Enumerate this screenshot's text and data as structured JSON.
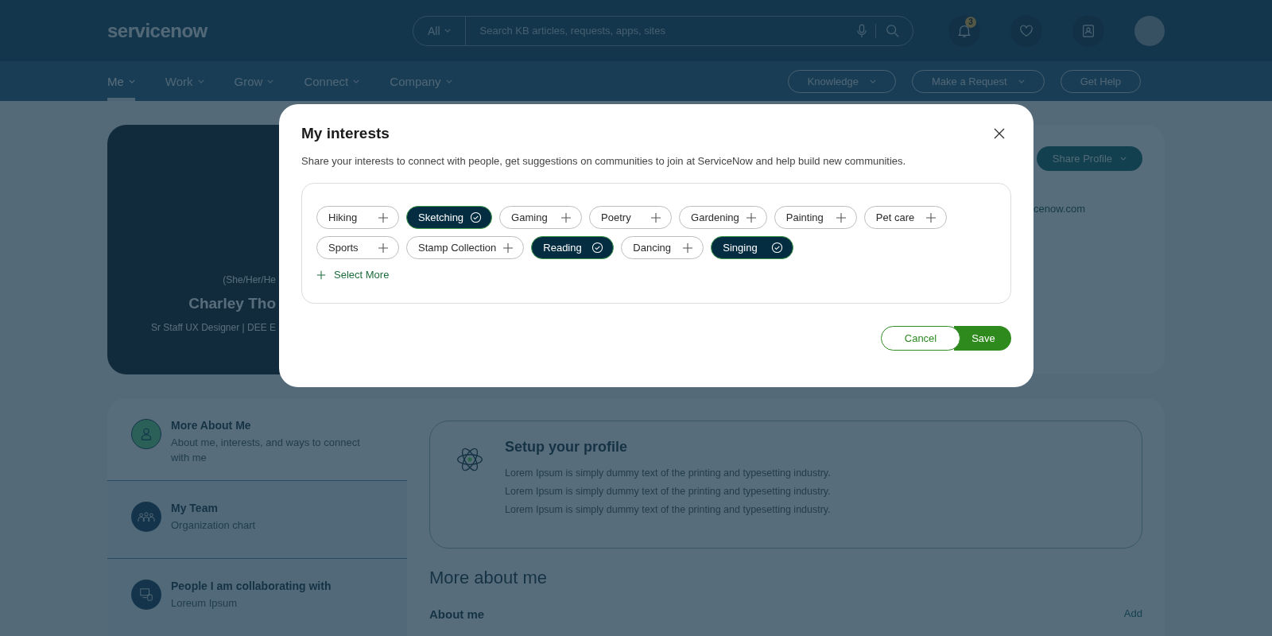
{
  "header": {
    "logo": "servicenow",
    "search": {
      "scope": "All",
      "placeholder": "Search KB articles, requests, apps, sites"
    },
    "notification_count": "3"
  },
  "nav": {
    "items": [
      {
        "label": "Me",
        "selected": true
      },
      {
        "label": "Work",
        "selected": false
      },
      {
        "label": "Grow",
        "selected": false
      },
      {
        "label": "Connect",
        "selected": false
      },
      {
        "label": "Company",
        "selected": false
      }
    ],
    "actions": [
      {
        "label": "Knowledge",
        "dropdown": true
      },
      {
        "label": "Make a Request",
        "dropdown": true
      },
      {
        "label": "Get Help",
        "dropdown": false
      }
    ]
  },
  "profile": {
    "pronouns": "(She/Her/He",
    "name": "Charley Tho",
    "title": "Sr Staff UX Designer | DEE E",
    "share_button": "Share Profile",
    "email": "cenow.com"
  },
  "sections": [
    {
      "title": "More About Me",
      "subtitle": "About me, interests, and ways to connect with me",
      "kind": "person",
      "selected": true
    },
    {
      "title": "My Team",
      "subtitle": "Organization chart",
      "kind": "team",
      "selected": false
    },
    {
      "title": "People I am collaborating with",
      "subtitle": "Loreum Ipsum",
      "kind": "devices",
      "selected": false
    }
  ],
  "setup": {
    "title": "Setup your profile",
    "lines": [
      "Lorem Ipsum is simply dummy text of the printing and typesetting industry.",
      "Lorem Ipsum is simply dummy text of the printing and typesetting industry.",
      "Lorem Ipsum is simply dummy text of the printing and typesetting industry."
    ]
  },
  "more_about": {
    "heading": "More about me",
    "label": "About me",
    "add": "Add"
  },
  "dialog": {
    "title": "My interests",
    "description": "Share your interests to connect with people, get suggestions on communities to join at ServiceNow and help build new communities.",
    "interests": [
      {
        "label": "Hiking",
        "selected": false
      },
      {
        "label": "Sketching",
        "selected": true
      },
      {
        "label": "Gaming",
        "selected": false
      },
      {
        "label": "Poetry",
        "selected": false
      },
      {
        "label": "Gardening",
        "selected": false
      },
      {
        "label": "Painting",
        "selected": false
      },
      {
        "label": "Pet care",
        "selected": false
      },
      {
        "label": "Sports",
        "selected": false
      },
      {
        "label": "Stamp Collection",
        "selected": false
      },
      {
        "label": "Reading",
        "selected": true
      },
      {
        "label": "Dancing",
        "selected": false
      },
      {
        "label": "Singing",
        "selected": true
      }
    ],
    "select_more": "Select More",
    "cancel": "Cancel",
    "save": "Save"
  }
}
